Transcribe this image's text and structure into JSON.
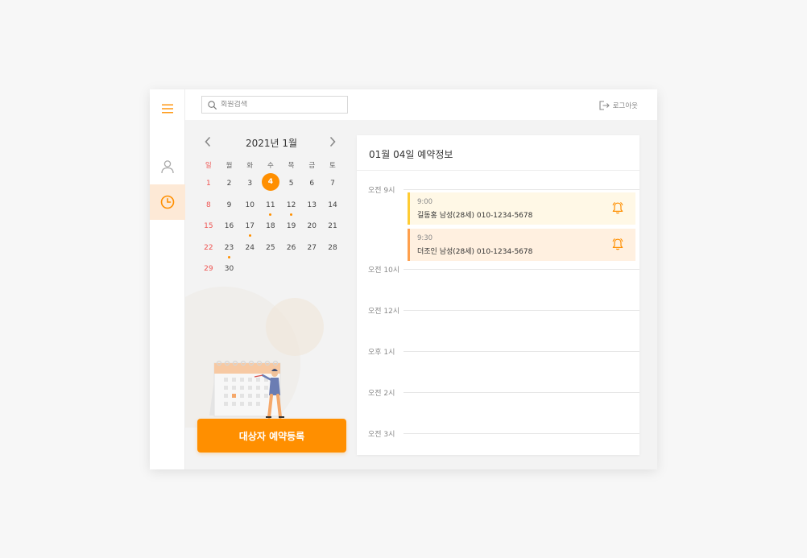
{
  "search": {
    "placeholder": "회원검색"
  },
  "topbar": {
    "logout_label": "로그아웃"
  },
  "calendar": {
    "title": "2021년 1월",
    "weekdays": [
      "일",
      "월",
      "화",
      "수",
      "목",
      "금",
      "토"
    ],
    "weeks": [
      [
        "1",
        "2",
        "3",
        "4",
        "5",
        "6",
        "7"
      ],
      [
        "8",
        "9",
        "10",
        "11",
        "12",
        "13",
        "14"
      ],
      [
        "15",
        "16",
        "17",
        "18",
        "19",
        "20",
        "21"
      ],
      [
        "22",
        "23",
        "24",
        "25",
        "26",
        "27",
        "28"
      ],
      [
        "29",
        "30",
        "",
        "",
        "",
        "",
        ""
      ]
    ],
    "selected_day": "4",
    "days_with_appointments": [
      "11",
      "12",
      "17",
      "23"
    ]
  },
  "register_button": "대상자 예약등록",
  "schedule": {
    "title": "01월 04일 예약정보",
    "slots": [
      "오전 9시",
      "오전 10시",
      "오전 12시",
      "오후 1시",
      "오전 2시",
      "오전 3시"
    ],
    "appointments": [
      {
        "time": "9:00",
        "info": "길동홍 남성(28세) 010-1234-5678"
      },
      {
        "time": "9:30",
        "info": "더조인 남성(28세) 010-1234-5678"
      }
    ]
  },
  "colors": {
    "accent": "#ff8f00",
    "sunday": "#ef5350",
    "nav_active_bg": "#fde9d6",
    "appointment_1_bg": "#fff8e6",
    "appointment_1_border": "#ffcc33",
    "appointment_2_bg": "#fff0e0",
    "appointment_2_border": "#ffa04d"
  },
  "icons": {
    "menu": "hamburger-menu-icon",
    "user": "user-icon",
    "clock": "clock-icon",
    "search": "search-icon",
    "logout": "logout-icon",
    "prev": "chevron-left-icon",
    "next": "chevron-right-icon",
    "bell": "bell-icon"
  }
}
